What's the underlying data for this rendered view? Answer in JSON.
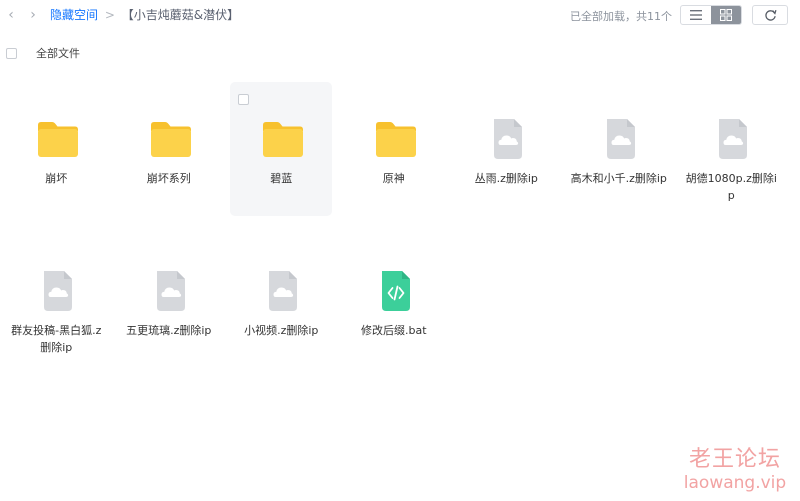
{
  "nav": {
    "back_icon": "chevron-left-icon",
    "forward_icon": "chevron-right-icon"
  },
  "breadcrumb": {
    "root": "隐藏空间",
    "separator": ">",
    "current": "【小吉炖蘑菇&潜伏】"
  },
  "status": {
    "loaded_text": "已全部加载，共11个"
  },
  "toolbar": {
    "list_view_icon": "list-view-icon",
    "grid_view_icon": "grid-view-icon",
    "refresh_icon": "refresh-icon",
    "active_view": "grid"
  },
  "selection": {
    "select_all_label": "全部文件"
  },
  "files": [
    {
      "name": "崩坏",
      "type": "folder"
    },
    {
      "name": "崩坏系列",
      "type": "folder"
    },
    {
      "name": "碧蓝",
      "type": "folder",
      "hovered": true
    },
    {
      "name": "原神",
      "type": "folder"
    },
    {
      "name": "丛雨.z删除ip",
      "type": "cloud-file"
    },
    {
      "name": "高木和小千.z删除ip",
      "type": "cloud-file"
    },
    {
      "name": "胡德1080p.z删除ip",
      "type": "cloud-file"
    },
    {
      "name": "群友投稿-黑白狐.z删除ip",
      "type": "cloud-file"
    },
    {
      "name": "五更琉璃.z删除ip",
      "type": "cloud-file"
    },
    {
      "name": "小视频.z删除ip",
      "type": "cloud-file"
    },
    {
      "name": "修改后缀.bat",
      "type": "code-file"
    }
  ],
  "watermark": {
    "title": "老王论坛",
    "url": "laowang.vip"
  },
  "colors": {
    "accent": "#1677ff",
    "folder": "#f7c12e",
    "cloud_file": "#d6d8dc",
    "code_file": "#3ccf9a",
    "watermark": "#f2a3a3"
  }
}
